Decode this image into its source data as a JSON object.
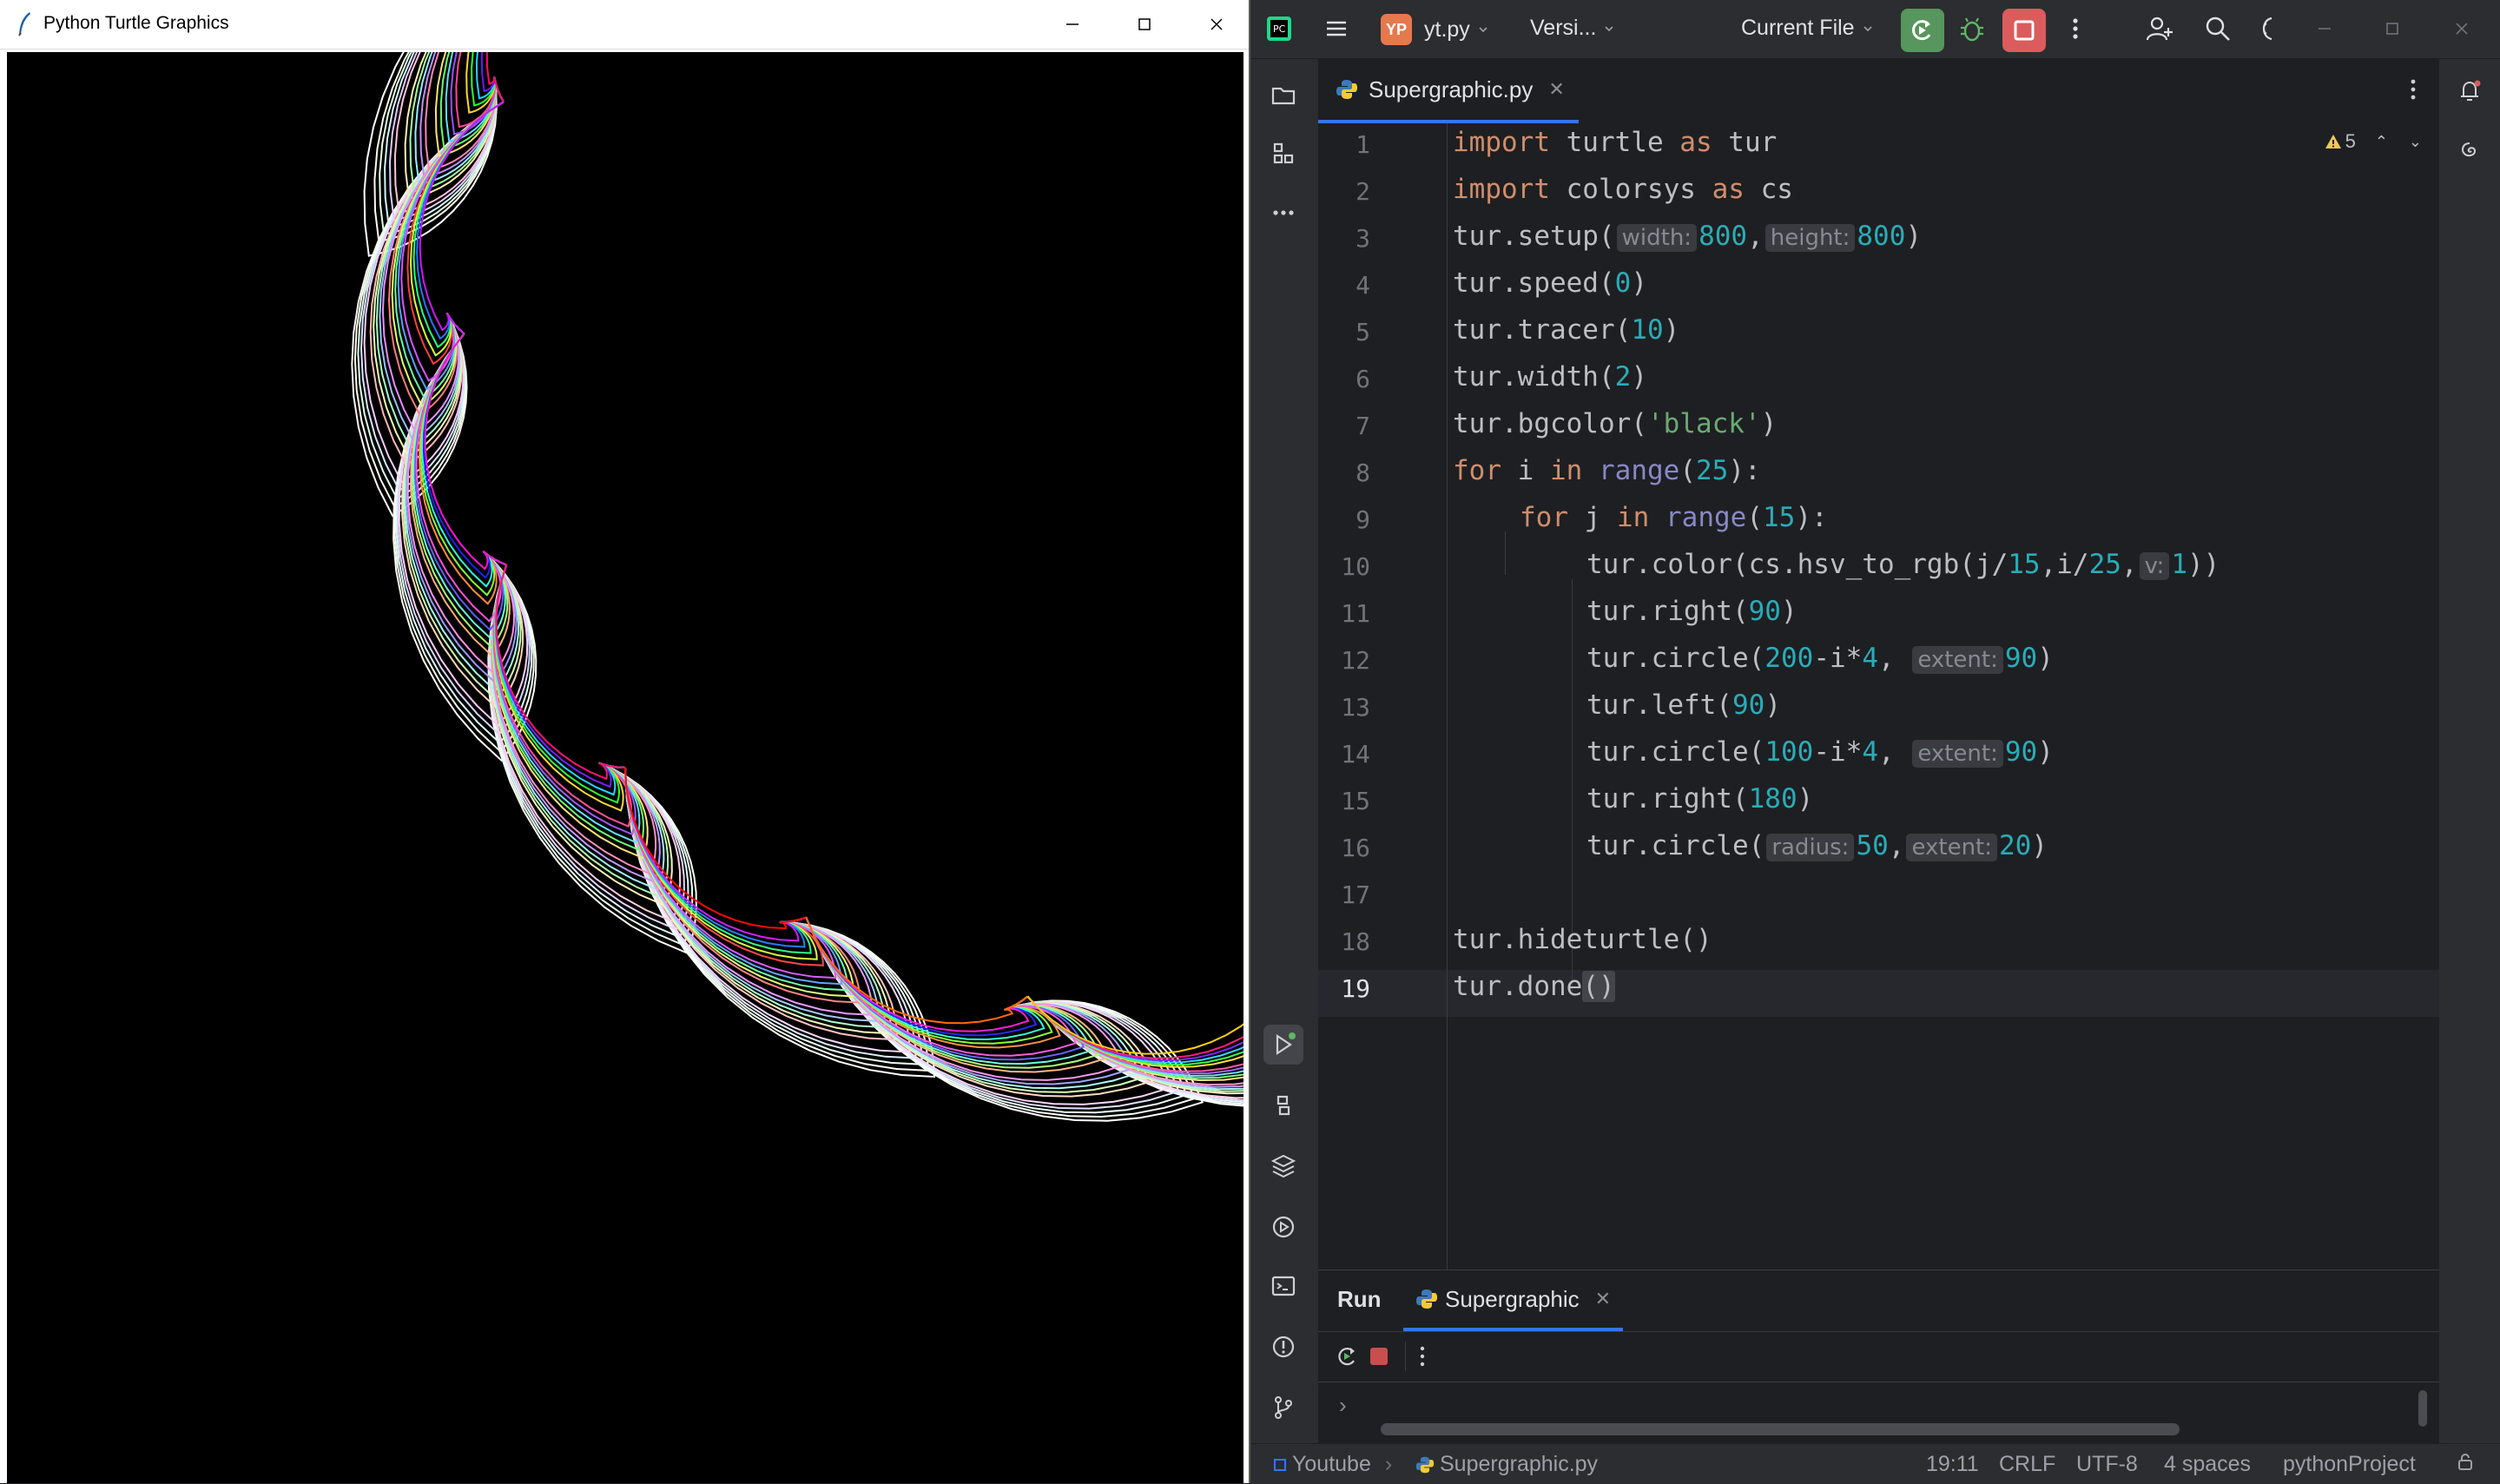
{
  "turtle_window": {
    "title": "Python Turtle Graphics",
    "minimize_icon": "minimize-icon",
    "maximize_icon": "maximize-icon",
    "close_icon": "close-icon",
    "canvas_background": "#000000"
  },
  "ide": {
    "header": {
      "project_badge": "YP",
      "project_name": "yt.py",
      "vcs_label": "Versi...",
      "run_config": "Current File",
      "run_color": "#57965c",
      "stop_color": "#db5c5c"
    },
    "editor_tab": {
      "label": "Supergraphic.py"
    },
    "warnings_count": "5",
    "code_lines": [
      "1",
      "2",
      "3",
      "4",
      "5",
      "6",
      "7",
      "8",
      "9",
      "10",
      "11",
      "12",
      "13",
      "14",
      "15",
      "16",
      "17",
      "18",
      "19"
    ],
    "current_line": "19",
    "code": {
      "l1": [
        "import",
        " turtle ",
        "as",
        " tur"
      ],
      "l2": [
        "import",
        " colorsys ",
        "as",
        " cs"
      ],
      "l3": [
        "tur.setup(",
        "width:",
        "800",
        ",",
        "height:",
        "800",
        ")"
      ],
      "l4": [
        "tur.speed(",
        "0",
        ")"
      ],
      "l5": [
        "tur.tracer(",
        "10",
        ")"
      ],
      "l6": [
        "tur.width(",
        "2",
        ")"
      ],
      "l7": [
        "tur.bgcolor(",
        "'black'",
        ")"
      ],
      "l8": [
        "for",
        " i ",
        "in",
        " ",
        "range",
        "(",
        "25",
        "):"
      ],
      "l9": [
        "for",
        " j ",
        "in",
        " ",
        "range",
        "(",
        "15",
        "):"
      ],
      "l10": [
        "tur.color(cs.hsv_to_rgb(j/",
        "15",
        ",",
        "i/",
        "25",
        ",",
        "v:",
        "1",
        "))"
      ],
      "l11": [
        "tur.right(",
        "90",
        ")"
      ],
      "l12": [
        "tur.circle(",
        "200",
        "-i*",
        "4",
        ", ",
        "extent:",
        "90",
        ")"
      ],
      "l13": [
        "tur.left(",
        "90",
        ")"
      ],
      "l14": [
        "tur.circle(",
        "100",
        "-i*",
        "4",
        ", ",
        "extent:",
        "90",
        ")"
      ],
      "l15": [
        "tur.right(",
        "180",
        ")"
      ],
      "l16": [
        "tur.circle(",
        "radius:",
        "50",
        ",",
        "extent:",
        "20",
        ")"
      ],
      "l18": [
        "tur.hideturtle()"
      ],
      "l19": [
        "tur.done",
        "()"
      ]
    },
    "run_panel": {
      "title": "Run",
      "config_tab": "Supergraphic"
    },
    "status_bar": {
      "project": "Youtube",
      "file": "Supergraphic.py",
      "position": "19:11",
      "line_sep": "CRLF",
      "encoding": "UTF-8",
      "indent": "4 spaces",
      "interpreter": "pythonProject"
    }
  }
}
